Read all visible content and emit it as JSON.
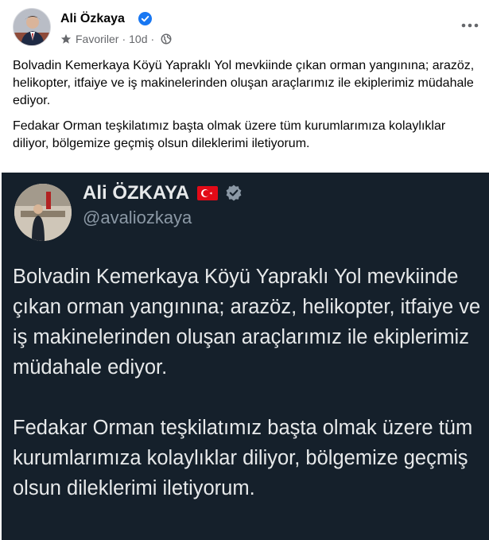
{
  "post": {
    "author": "Ali Özkaya",
    "audience": "Favoriler",
    "time": "10d",
    "paragraphs": [
      "Bolvadin Kemerkaya Köyü Yapraklı Yol mevkiinde çıkan orman yangınına; arazöz, helikopter, itfaiye ve iş makinelerinden oluşan araçlarımız ile ekiplerimiz müdahale ediyor.",
      "Fedakar Orman teşkilatımız başta olmak üzere tüm kurumlarımıza kolaylıklar diliyor, bölgemize geçmiş olsun dileklerimi iletiyorum."
    ],
    "icons": {
      "audience": "star-icon",
      "privacy": "globe-icon",
      "verified": "verified-badge-icon",
      "menu": "more-options-icon"
    }
  },
  "tweet": {
    "name": "Ali ÖZKAYA",
    "handle": "@avaliozkaya",
    "paragraphs": [
      "Bolvadin Kemerkaya Köyü Yapraklı Yol mevkiinde çıkan orman yangınına; arazöz, helikopter, itfaiye ve iş makinelerinden oluşan araçlarımız ile ekiplerimiz müdahale ediyor.",
      "Fedakar Orman teşkilatımız başta olmak üzere tüm kurumlarımıza kolaylıklar diliyor, bölgemize geçmiş olsun dileklerimi iletiyorum."
    ],
    "icons": {
      "flag": "turkey-flag-icon",
      "verified": "verified-badge-icon"
    }
  },
  "colors": {
    "facebook_blue": "#1877f2",
    "tweet_background": "#15202b",
    "tweet_text": "#e7e9ea",
    "tweet_handle": "#8b98a5",
    "meta_gray": "#65676b",
    "flag_red": "#e30a17"
  }
}
